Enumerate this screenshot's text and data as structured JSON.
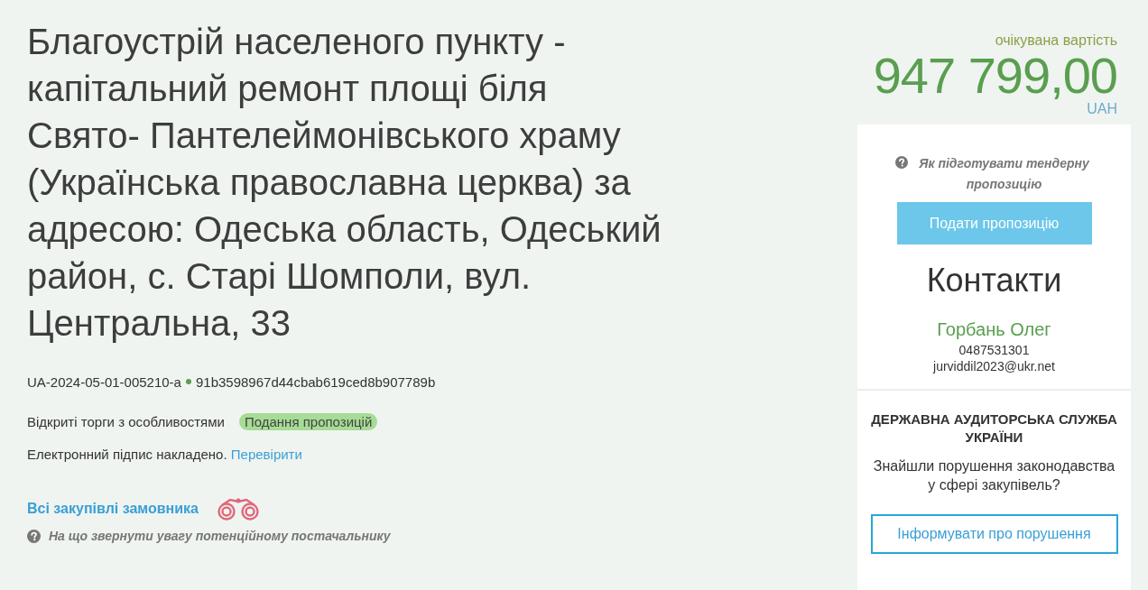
{
  "tender": {
    "title": "Благоустрій населеного пункту - капітальний ремонт площі біля Свято- Пантелеймонівського храму (Українська православна церква) за адресою: Одеська область, Одеський район, с. Старі Шомполи, вул. Центральна, 33",
    "id": "UA-2024-05-01-005210-a",
    "hash": "91b3598967d44cbab619ced8b907789b",
    "procedure": "Відкриті торги з особливостями",
    "status_badge": "Подання пропозицій",
    "signature": {
      "text": "Електронний підпис накладено.",
      "link": "Перевірити"
    },
    "customer_link": "Всі закупівлі замовника",
    "hint": "На що звернути увагу потенційному постачальнику"
  },
  "price": {
    "label": "очікувана вартість",
    "amount": "947 799,00",
    "currency": "UAH"
  },
  "sidebar": {
    "help_link": "Як підготувати тендерну пропозицію",
    "submit_button": "Подати пропозицію",
    "contacts": {
      "heading": "Контакти",
      "name": "Горбань Олег",
      "phone": "0487531301",
      "email": "jurviddil2023@ukr.net"
    },
    "audit": {
      "title": "ДЕРЖАВНА АУДИТОРСЬКА СЛУЖБА УКРАЇНИ",
      "text": "Знайшли порушення законодавства у сфері закупівель?",
      "button": "Інформувати про порушення"
    }
  }
}
